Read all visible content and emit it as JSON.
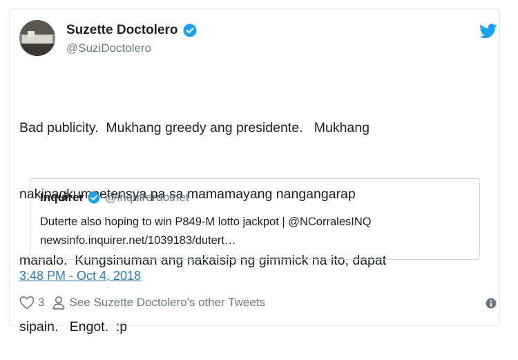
{
  "author": {
    "name": "Suzette Doctolero",
    "handle": "@SuziDoctolero"
  },
  "tweet": {
    "lines": [
      "Bad publicity.  Mukhang greedy ang presidente.   Mukhang",
      "nakipagkumpetensya pa sa mamamayang nangangarap",
      "manalo.  Kungsinuman ang nakaisip ng gimmick na ito, dapat",
      "sipain.   Engot.  :p"
    ]
  },
  "quoted": {
    "name": "Inquirer",
    "handle": "@inquirerdotnet",
    "line1": "Duterte also hoping to win P849-M lotto jackpot | @NCorralesINQ",
    "line2": "newsinfo.inquirer.net/1039183/dutert…"
  },
  "meta": {
    "timestamp": "3:48 PM - Oct 4, 2018",
    "like_count": "3",
    "see_more": "See Suzette Doctolero's other Tweets"
  },
  "colors": {
    "twitter_blue": "#1da1f2",
    "link_blue": "#2b7bb9",
    "muted_gray": "#697882",
    "border": "#e1e8ed"
  },
  "icons": [
    "twitter-bird-icon",
    "verified-badge-icon",
    "heart-icon",
    "person-icon",
    "info-icon"
  ]
}
